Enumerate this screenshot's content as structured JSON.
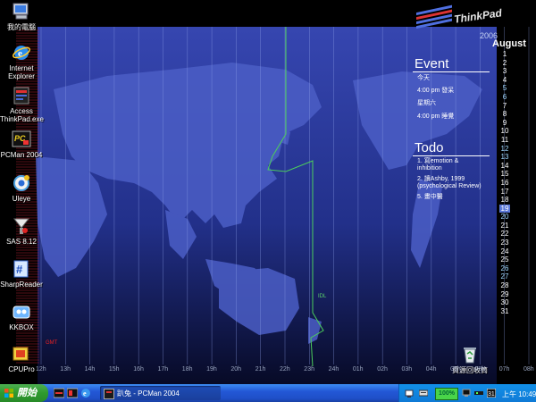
{
  "desktop_icons": [
    {
      "name": "my-computer",
      "label": "我的電腦"
    },
    {
      "name": "internet-explorer",
      "label": "Internet\nExplorer"
    },
    {
      "name": "access-thinkpad",
      "label": "Access\nThinkPad.exe"
    },
    {
      "name": "pcman",
      "label": "PCMan 2004"
    },
    {
      "name": "uleye",
      "label": "Uleye"
    },
    {
      "name": "sas",
      "label": "SAS 8.12"
    },
    {
      "name": "sharpreader",
      "label": "SharpReader"
    },
    {
      "name": "kkbox",
      "label": "KKBOX"
    },
    {
      "name": "cpupro",
      "label": "CPUPro"
    },
    {
      "name": "recycle-bin",
      "label": "資源回收筒"
    }
  ],
  "brand": "ThinkPad",
  "calendar": {
    "year": "2006",
    "month": "August",
    "today": 19,
    "days": [
      "1",
      "2",
      "3",
      "4",
      "5",
      "6",
      "7",
      "8",
      "9",
      "10",
      "11",
      "12",
      "13",
      "14",
      "15",
      "16",
      "17",
      "18",
      "19",
      "20",
      "21",
      "22",
      "23",
      "24",
      "25",
      "26",
      "27",
      "28",
      "29",
      "30",
      "31"
    ]
  },
  "event": {
    "title": "Event",
    "items": [
      "今天",
      "4:00 pm 發呆",
      "星期六",
      "4:00 pm 睡覺"
    ]
  },
  "todo": {
    "title": "Todo",
    "items": [
      "1. 寫emotion &\ninhibition",
      "2. 讀Ashby, 1999\n(psychological Review)",
      "5. 畫中醫"
    ]
  },
  "map_labels": {
    "idl": "IDL",
    "gmt": "GMT"
  },
  "timezones": [
    "12h",
    "13h",
    "14h",
    "15h",
    "16h",
    "17h",
    "18h",
    "19h",
    "20h",
    "21h",
    "22h",
    "23h",
    "24h",
    "01h",
    "02h",
    "03h",
    "04h",
    "05h",
    "06h",
    "07h",
    "08h"
  ],
  "taskbar": {
    "start_label": "開始",
    "task_label": "趴兔 - PCMan 2004",
    "battery": "100%",
    "clock": "上午 10:49"
  },
  "colors": {
    "wallpaper_top": "#3548b0",
    "wallpaper_bottom": "#0a0c30",
    "taskbar": "#245edb",
    "start": "#2e9a2e"
  }
}
